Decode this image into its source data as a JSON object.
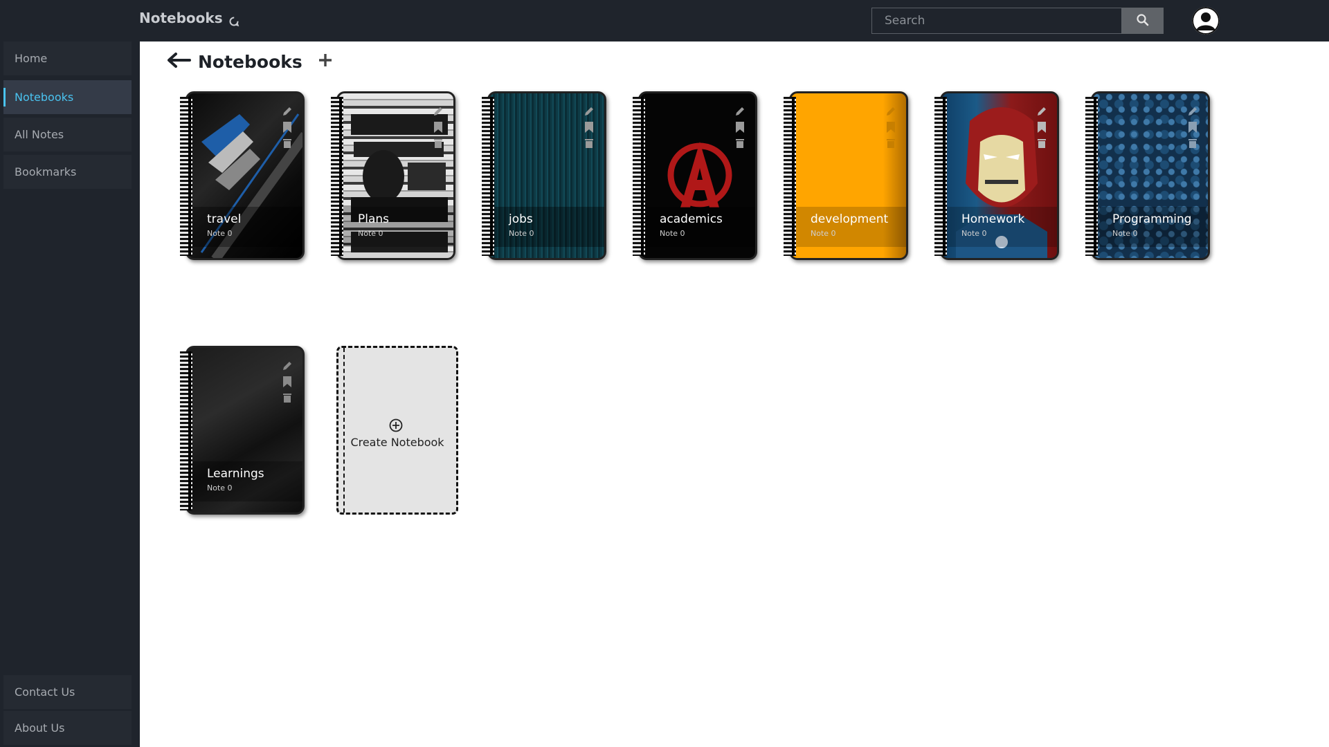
{
  "app": {
    "title": "Notebooks"
  },
  "search": {
    "placeholder": "Search"
  },
  "sidebar": {
    "items": [
      {
        "label": "Home"
      },
      {
        "label": "Notebooks"
      },
      {
        "label": "All Notes"
      },
      {
        "label": "Bookmarks"
      }
    ],
    "footer": [
      {
        "label": "Contact Us"
      },
      {
        "label": "About Us"
      }
    ]
  },
  "main": {
    "title": "Notebooks",
    "notebooks": [
      {
        "name": "travel",
        "count": "Note 0"
      },
      {
        "name": "Plans",
        "count": "Note 0"
      },
      {
        "name": "jobs",
        "count": "Note 0"
      },
      {
        "name": "academics",
        "count": "Note 0"
      },
      {
        "name": "development",
        "count": "Note 0"
      },
      {
        "name": "Homework",
        "count": "Note 0"
      },
      {
        "name": "Programming",
        "count": "Note 0"
      },
      {
        "name": "Learnings",
        "count": "Note 0"
      }
    ],
    "create_label": "Create Notebook"
  },
  "colors": {
    "accent": "#4ac3f0",
    "sidebar_bg": "#1f242c",
    "topbar_bg": "#1f242c"
  }
}
